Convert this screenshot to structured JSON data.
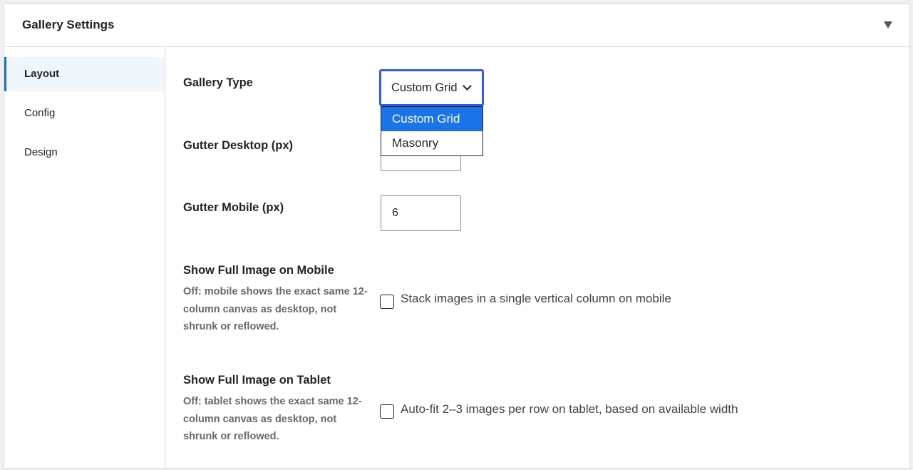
{
  "panel": {
    "title": "Gallery Settings",
    "toggle_icon": "triangle-down-icon"
  },
  "tabs": [
    {
      "label": "Layout",
      "active": true
    },
    {
      "label": "Config",
      "active": false
    },
    {
      "label": "Design",
      "active": false
    }
  ],
  "fields": {
    "gallery_type": {
      "label": "Gallery Type",
      "value": "Custom Grid",
      "options": [
        "Custom Grid",
        "Masonry"
      ],
      "selected_option": "Custom Grid"
    },
    "gutter_desktop": {
      "label": "Gutter Desktop (px)",
      "value": ""
    },
    "gutter_mobile": {
      "label": "Gutter Mobile (px)",
      "value": "6"
    },
    "full_image_mobile": {
      "label": "Show Full Image on Mobile",
      "description": "Off: mobile shows the exact same 12-column canvas as desktop, not shrunk or reflowed.",
      "checkbox_label": "Stack images in a single vertical column on mobile",
      "checked": false
    },
    "full_image_tablet": {
      "label": "Show Full Image on Tablet",
      "description": "Off: tablet shows the exact same 12-column canvas as desktop, not shrunk or reflowed.",
      "checkbox_label": "Auto-fit 2–3 images per row on tablet, based on available width",
      "checked": false
    }
  },
  "colors": {
    "accent_blue": "#3858e9",
    "selected_option_bg": "#1a73e8",
    "active_tab_bg": "#f0f6fc",
    "active_tab_border": "#2271b1"
  }
}
